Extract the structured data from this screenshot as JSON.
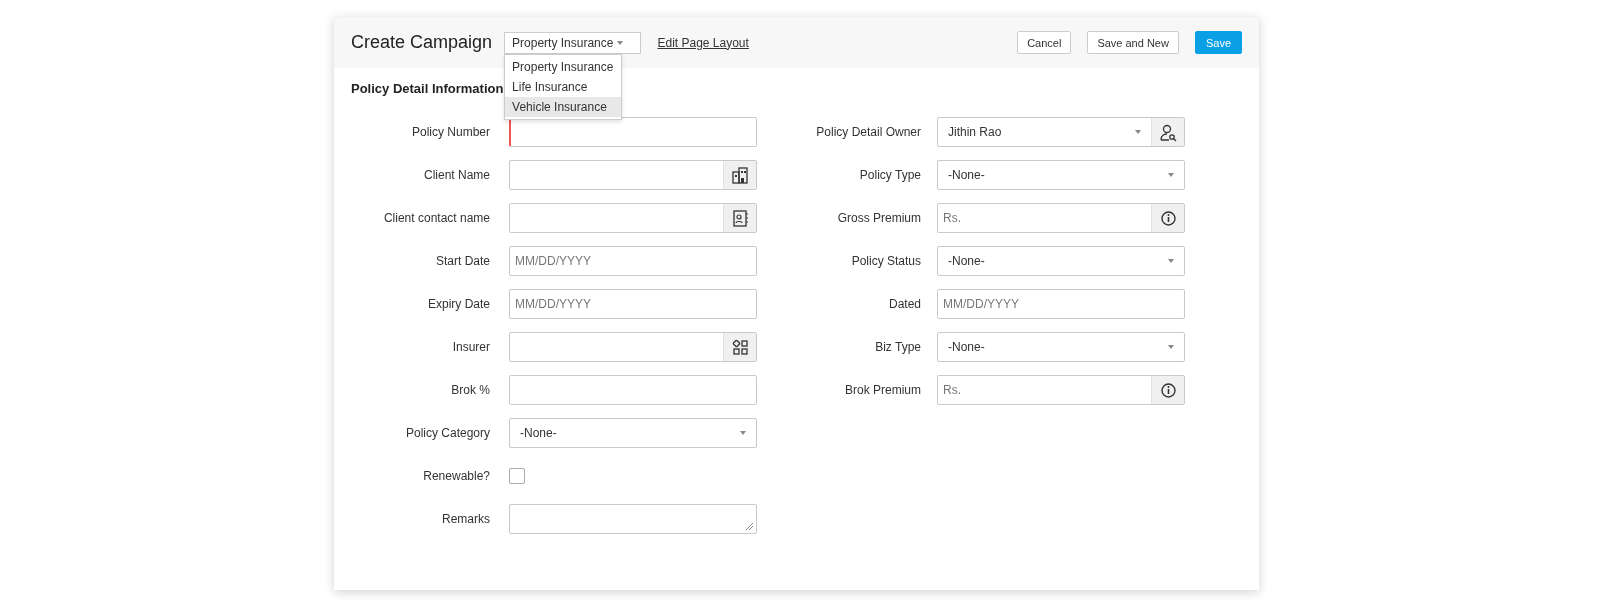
{
  "header": {
    "title": "Create Campaign",
    "layout_select": {
      "value": "Property Insurance",
      "expanded": true,
      "options": [
        {
          "label": "Property Insurance",
          "highlighted": false
        },
        {
          "label": "Life Insurance",
          "highlighted": false
        },
        {
          "label": "Vehicle Insurance",
          "highlighted": true
        }
      ]
    },
    "edit_link": "Edit Page Layout",
    "buttons": [
      {
        "label": "Cancel",
        "kind": "secondary"
      },
      {
        "label": "Save and New",
        "kind": "secondary"
      },
      {
        "label": "Save",
        "kind": "primary"
      }
    ]
  },
  "section_title": "Policy Detail Information",
  "left_fields": [
    {
      "label": "Policy Number",
      "kind": "text",
      "required": true
    },
    {
      "label": "Client Name",
      "kind": "account_lookup",
      "required": false
    },
    {
      "label": "Client contact name",
      "kind": "contact_lookup",
      "required": false
    },
    {
      "label": "Start Date",
      "kind": "date",
      "placeholder": "MM/DD/YYYY",
      "required": false
    },
    {
      "label": "Expiry Date",
      "kind": "date",
      "placeholder": "MM/DD/YYYY",
      "required": false
    },
    {
      "label": "Insurer",
      "kind": "vendor_lookup",
      "required": false
    },
    {
      "label": "Brok %",
      "kind": "text",
      "required": false
    },
    {
      "label": "Policy Category",
      "kind": "select",
      "value": "-None-",
      "required": false
    },
    {
      "label": "Renewable?",
      "kind": "checkbox",
      "checked": false
    },
    {
      "label": "Remarks",
      "kind": "textarea",
      "required": false
    }
  ],
  "right_fields": [
    {
      "label": "Policy Detail Owner",
      "kind": "user_lookup",
      "value": "Jithin Rao",
      "required": false
    },
    {
      "label": "Policy Type",
      "kind": "select",
      "value": "-None-",
      "required": false
    },
    {
      "label": "Gross Premium",
      "kind": "currency",
      "placeholder": "Rs.",
      "required": false
    },
    {
      "label": "Policy Status",
      "kind": "select",
      "value": "-None-",
      "required": false
    },
    {
      "label": "Dated",
      "kind": "date",
      "placeholder": "MM/DD/YYYY",
      "required": false
    },
    {
      "label": "Biz Type",
      "kind": "select",
      "value": "-None-",
      "required": false
    },
    {
      "label": "Brok Premium",
      "kind": "currency",
      "placeholder": "Rs.",
      "required": false
    }
  ]
}
